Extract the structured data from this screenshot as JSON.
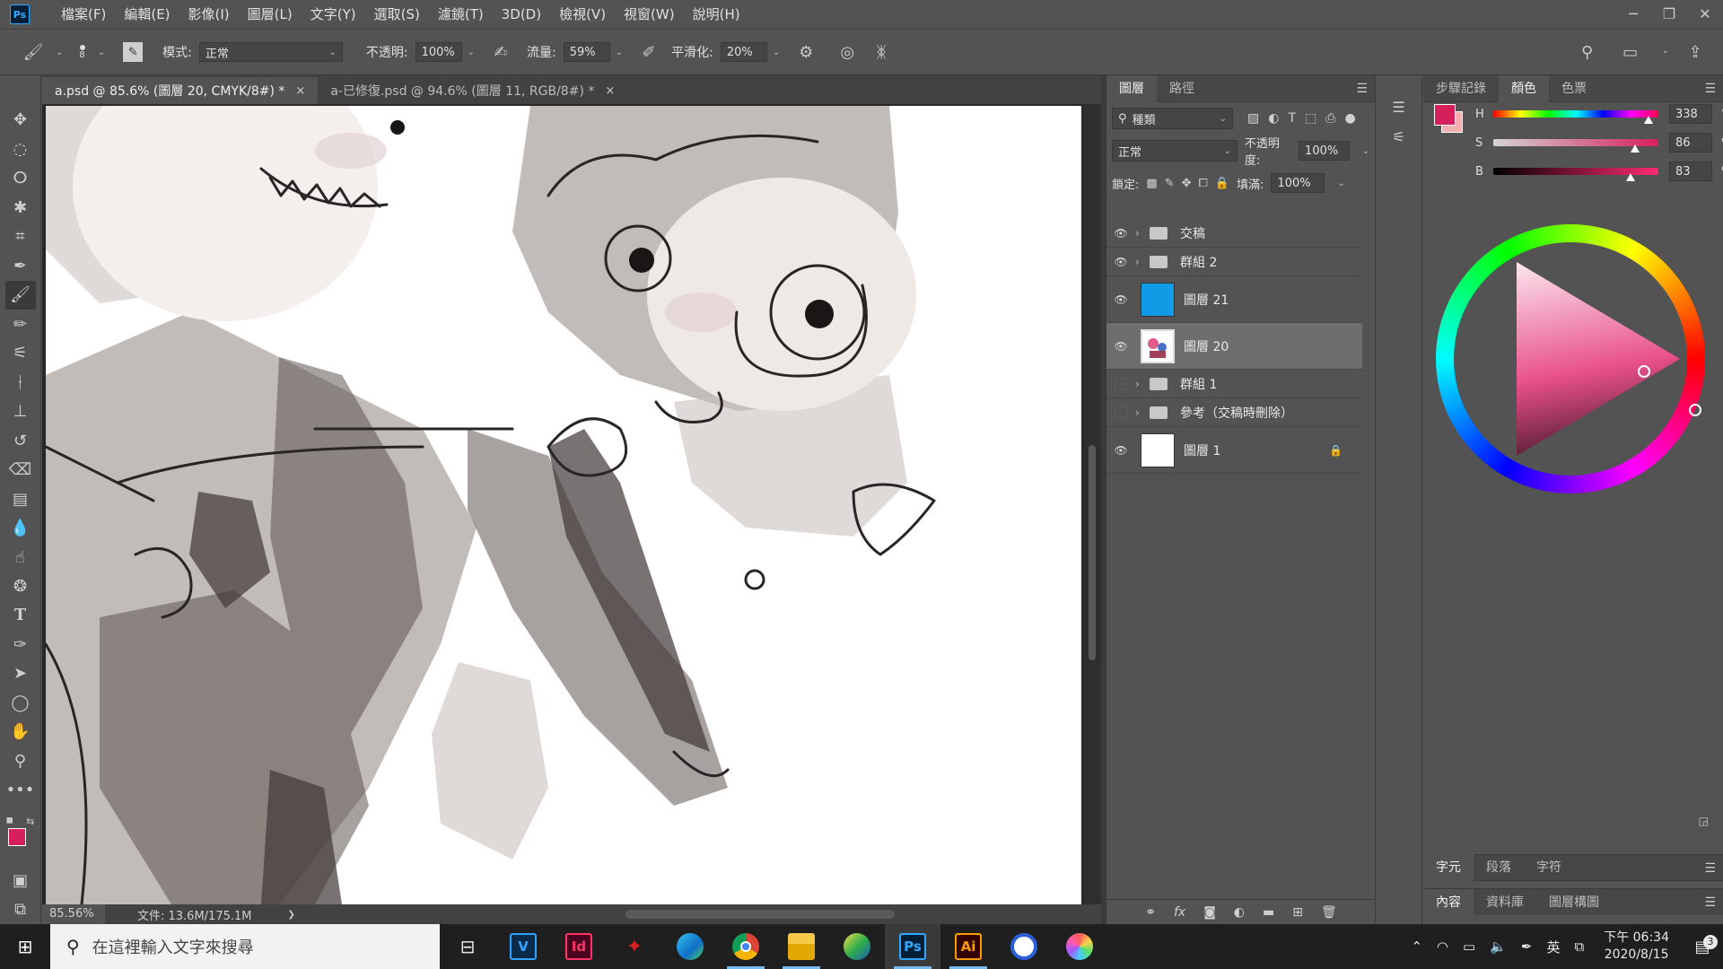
{
  "app": {
    "logo": "Ps"
  },
  "menu": [
    "檔案(F)",
    "編輯(E)",
    "影像(I)",
    "圖層(L)",
    "文字(Y)",
    "選取(S)",
    "濾鏡(T)",
    "3D(D)",
    "檢視(V)",
    "視窗(W)",
    "說明(H)"
  ],
  "options": {
    "brush_size": "8",
    "mode_label": "模式:",
    "mode_value": "正常",
    "opacity_label": "不透明:",
    "opacity_value": "100%",
    "flow_label": "流量:",
    "flow_value": "59%",
    "smoothing_label": "平滑化:",
    "smoothing_value": "20%"
  },
  "tabs": [
    {
      "label": "a.psd @ 85.6% (圖層 20, CMYK/8#) *",
      "close": "×"
    },
    {
      "label": "a-已修復.psd @ 94.6% (圖層 11, RGB/8#) *",
      "close": "×"
    }
  ],
  "status": {
    "zoom": "85.56%",
    "doc_info": "文件: 13.6M/175.1M",
    "arrow": "❯"
  },
  "layers_panel": {
    "tabs": [
      "圖層",
      "路徑"
    ],
    "filter_value": "種類",
    "blend_mode": "正常",
    "opacity_label": "不透明度:",
    "opacity_value": "100%",
    "lock_label": "鎖定:",
    "fill_label": "填滿:",
    "fill_value": "100%",
    "layers": [
      {
        "name": "交稿",
        "visible": true,
        "type": "group"
      },
      {
        "name": "群組 2",
        "visible": true,
        "type": "group"
      },
      {
        "name": "圖層 21",
        "visible": true,
        "type": "fill",
        "color": "#119ae5"
      },
      {
        "name": "圖層 20",
        "visible": true,
        "type": "image",
        "selected": true
      },
      {
        "name": "群組 1",
        "visible": false,
        "type": "group"
      },
      {
        "name": "參考（交稿時刪除）",
        "visible": false,
        "type": "group"
      },
      {
        "name": "圖層 1",
        "visible": true,
        "type": "white",
        "locked": true
      }
    ]
  },
  "color_panel": {
    "tabs": [
      "步驟記錄",
      "顏色",
      "色票"
    ],
    "h_label": "H",
    "h_value": "338",
    "h_unit": "°",
    "h_level": 0.939,
    "s_label": "S",
    "s_value": "86",
    "s_unit": "%",
    "s_level": 0.86,
    "b_label": "B",
    "b_value": "83",
    "b_unit": "%",
    "b_level": 0.83,
    "fg_color": "#d6205c",
    "bg_color": "#f3b0ae",
    "bottom_tabs_1": [
      "字元",
      "段落",
      "字符"
    ],
    "bottom_tabs_2": [
      "內容",
      "資料庫",
      "圖層構圖"
    ]
  },
  "taskbar": {
    "search_placeholder": "在這裡輸入文字來搜尋",
    "apps": [
      {
        "name": "task-view-icon",
        "label": "⊟"
      },
      {
        "name": "vegas-icon",
        "label": "V"
      },
      {
        "name": "indesign-icon",
        "label": "Id"
      },
      {
        "name": "red-app-icon",
        "label": ""
      },
      {
        "name": "edge-icon",
        "label": ""
      },
      {
        "name": "chrome-icon",
        "label": ""
      },
      {
        "name": "file-explorer-icon",
        "label": ""
      },
      {
        "name": "gradient-app-icon",
        "label": ""
      },
      {
        "name": "photoshop-icon",
        "label": "Ps"
      },
      {
        "name": "illustrator-icon",
        "label": "Ai"
      },
      {
        "name": "blue-circle-app-icon",
        "label": ""
      },
      {
        "name": "color-wheel-app-icon",
        "label": ""
      }
    ],
    "ime": "英",
    "time": "下午 06:34",
    "date": "2020/8/15",
    "notifications": "3"
  }
}
